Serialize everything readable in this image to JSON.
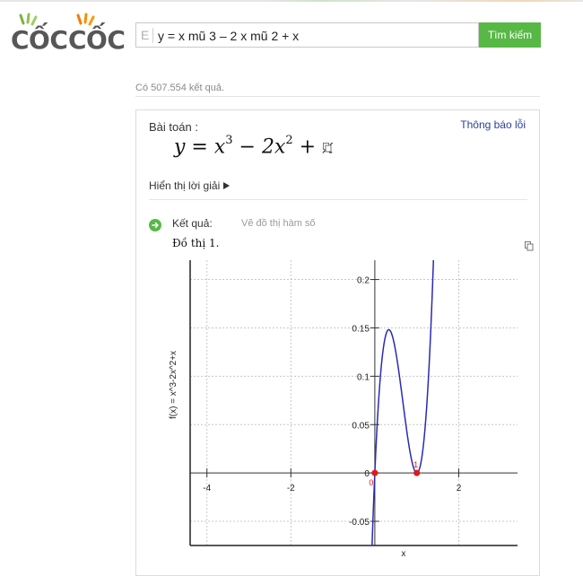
{
  "logo": {
    "word1": "CỐC",
    "word2": "CỐC"
  },
  "search": {
    "prefix": "E",
    "value": "y = x mũ 3 – 2 x mũ 2 + x",
    "button": "Tìm kiếm"
  },
  "results": {
    "count_text": "Có 507.554 kết quả."
  },
  "card": {
    "problem_label": "Bài toán :",
    "report_link": "Thông báo lỗi",
    "formula": {
      "y": "y",
      "eq": " = ",
      "x1": "x",
      "exp1": "3",
      "minus": " − 2",
      "x2": "x",
      "exp2": "2",
      "plus": " + ",
      "x3": "x"
    },
    "show_solution": "Hiển thị lời giải",
    "result_label": "Kết quả:",
    "result_subtitle": "Vẽ đồ thị hàm số",
    "graph_title": "Đồ thị 1."
  },
  "colors": {
    "accent_green": "#57b846",
    "link_blue": "#2a3f9e",
    "curve_blue": "#2a2ab8",
    "point_red": "#e01919"
  },
  "chart_data": {
    "type": "line",
    "function": "x^3-2x^2+x",
    "ylabel": "f(x) = x^3-2x^2+x",
    "xlabel": "x",
    "xlim": [
      -4.4,
      3.4
    ],
    "ylim": [
      -0.075,
      0.22
    ],
    "x_ticks": [
      -4,
      -2,
      0,
      2
    ],
    "y_ticks": [
      -0.05,
      0,
      0.05,
      0.1,
      0.15,
      0.2
    ],
    "grid": true,
    "points": [
      {
        "x": 0,
        "y": 0,
        "label": "0"
      },
      {
        "x": 1,
        "y": 0,
        "label": "1"
      }
    ]
  }
}
